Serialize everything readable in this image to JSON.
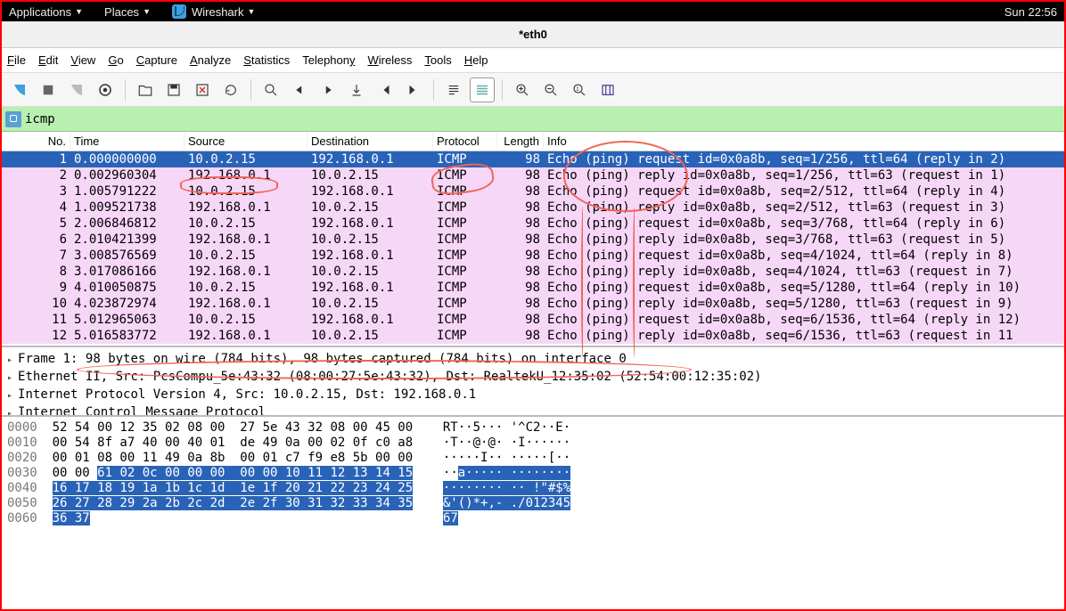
{
  "topbar": {
    "applications": "Applications",
    "places": "Places",
    "wireshark": "Wireshark",
    "clock": "Sun 22:56"
  },
  "window": {
    "title": "*eth0"
  },
  "menubar": [
    "File",
    "Edit",
    "View",
    "Go",
    "Capture",
    "Analyze",
    "Statistics",
    "Telephony",
    "Wireless",
    "Tools",
    "Help"
  ],
  "filter": {
    "value": "icmp"
  },
  "columns": {
    "no": "No.",
    "time": "Time",
    "source": "Source",
    "destination": "Destination",
    "protocol": "Protocol",
    "length": "Length",
    "info": "Info"
  },
  "packets": [
    {
      "no": "1",
      "time": "0.000000000",
      "src": "10.0.2.15",
      "dst": "192.168.0.1",
      "proto": "ICMP",
      "len": "98",
      "info": "Echo (ping) request  id=0x0a8b, seq=1/256, ttl=64 (reply in 2)",
      "sel": true
    },
    {
      "no": "2",
      "time": "0.002960304",
      "src": "192.168.0.1",
      "dst": "10.0.2.15",
      "proto": "ICMP",
      "len": "98",
      "info": "Echo (ping) reply    id=0x0a8b, seq=1/256, ttl=63 (request in 1)"
    },
    {
      "no": "3",
      "time": "1.005791222",
      "src": "10.0.2.15",
      "dst": "192.168.0.1",
      "proto": "ICMP",
      "len": "98",
      "info": "Echo (ping) request  id=0x0a8b, seq=2/512, ttl=64 (reply in 4)"
    },
    {
      "no": "4",
      "time": "1.009521738",
      "src": "192.168.0.1",
      "dst": "10.0.2.15",
      "proto": "ICMP",
      "len": "98",
      "info": "Echo (ping) reply    id=0x0a8b, seq=2/512, ttl=63 (request in 3)"
    },
    {
      "no": "5",
      "time": "2.006846812",
      "src": "10.0.2.15",
      "dst": "192.168.0.1",
      "proto": "ICMP",
      "len": "98",
      "info": "Echo (ping) request  id=0x0a8b, seq=3/768, ttl=64 (reply in 6)"
    },
    {
      "no": "6",
      "time": "2.010421399",
      "src": "192.168.0.1",
      "dst": "10.0.2.15",
      "proto": "ICMP",
      "len": "98",
      "info": "Echo (ping) reply    id=0x0a8b, seq=3/768, ttl=63 (request in 5)"
    },
    {
      "no": "7",
      "time": "3.008576569",
      "src": "10.0.2.15",
      "dst": "192.168.0.1",
      "proto": "ICMP",
      "len": "98",
      "info": "Echo (ping) request  id=0x0a8b, seq=4/1024, ttl=64 (reply in 8)"
    },
    {
      "no": "8",
      "time": "3.017086166",
      "src": "192.168.0.1",
      "dst": "10.0.2.15",
      "proto": "ICMP",
      "len": "98",
      "info": "Echo (ping) reply    id=0x0a8b, seq=4/1024, ttl=63 (request in 7)"
    },
    {
      "no": "9",
      "time": "4.010050875",
      "src": "10.0.2.15",
      "dst": "192.168.0.1",
      "proto": "ICMP",
      "len": "98",
      "info": "Echo (ping) request  id=0x0a8b, seq=5/1280, ttl=64 (reply in 10)"
    },
    {
      "no": "10",
      "time": "4.023872974",
      "src": "192.168.0.1",
      "dst": "10.0.2.15",
      "proto": "ICMP",
      "len": "98",
      "info": "Echo (ping) reply    id=0x0a8b, seq=5/1280, ttl=63 (request in 9)"
    },
    {
      "no": "11",
      "time": "5.012965063",
      "src": "10.0.2.15",
      "dst": "192.168.0.1",
      "proto": "ICMP",
      "len": "98",
      "info": "Echo (ping) request  id=0x0a8b, seq=6/1536, ttl=64 (reply in 12)"
    },
    {
      "no": "12",
      "time": "5.016583772",
      "src": "192.168.0.1",
      "dst": "10.0.2.15",
      "proto": "ICMP",
      "len": "98",
      "info": "Echo (ping) reply    id=0x0a8b, seq=6/1536, ttl=63 (request in 11"
    }
  ],
  "tree": {
    "frame": "Frame 1: 98 bytes on wire (784 bits), 98 bytes captured (784 bits) on interface 0",
    "eth": "Ethernet II, Src: PcsCompu_5e:43:32 (08:00:27:5e:43:32), Dst: RealtekU_12:35:02 (52:54:00:12:35:02)",
    "ip": "Internet Protocol Version 4, Src: 10.0.2.15, Dst: 192.168.0.1",
    "icmp": "Internet Control Message Protocol"
  },
  "hex": {
    "rows": [
      {
        "off": "0000",
        "b": "52 54 00 12 35 02 08 00  27 5e 43 32 08 00 45 00",
        "a": "RT··5··· '^C2··E·"
      },
      {
        "off": "0010",
        "b": "00 54 8f a7 40 00 40 01  de 49 0a 00 02 0f c0 a8",
        "a": "·T··@·@· ·I······"
      },
      {
        "off": "0020",
        "b": "00 01 08 00 11 49 0a 8b  00 01 c7 f9 e8 5b 00 00",
        "a": "·····I·· ·····[··"
      },
      {
        "off": "0030",
        "b1": "00 00 ",
        "bs": "61 02 0c 00 00 00  00 00 10 11 12 13 14 15",
        "a1": "··",
        "as": "a····· ········"
      },
      {
        "off": "0040",
        "bs": "16 17 18 19 1a 1b 1c 1d  1e 1f 20 21 22 23 24 25",
        "as": "········ ·· !\"#$%"
      },
      {
        "off": "0050",
        "bs": "26 27 28 29 2a 2b 2c 2d  2e 2f 30 31 32 33 34 35",
        "as": "&'()*+,- ./012345"
      },
      {
        "off": "0060",
        "bs": "36 37",
        "as": "67"
      }
    ]
  }
}
